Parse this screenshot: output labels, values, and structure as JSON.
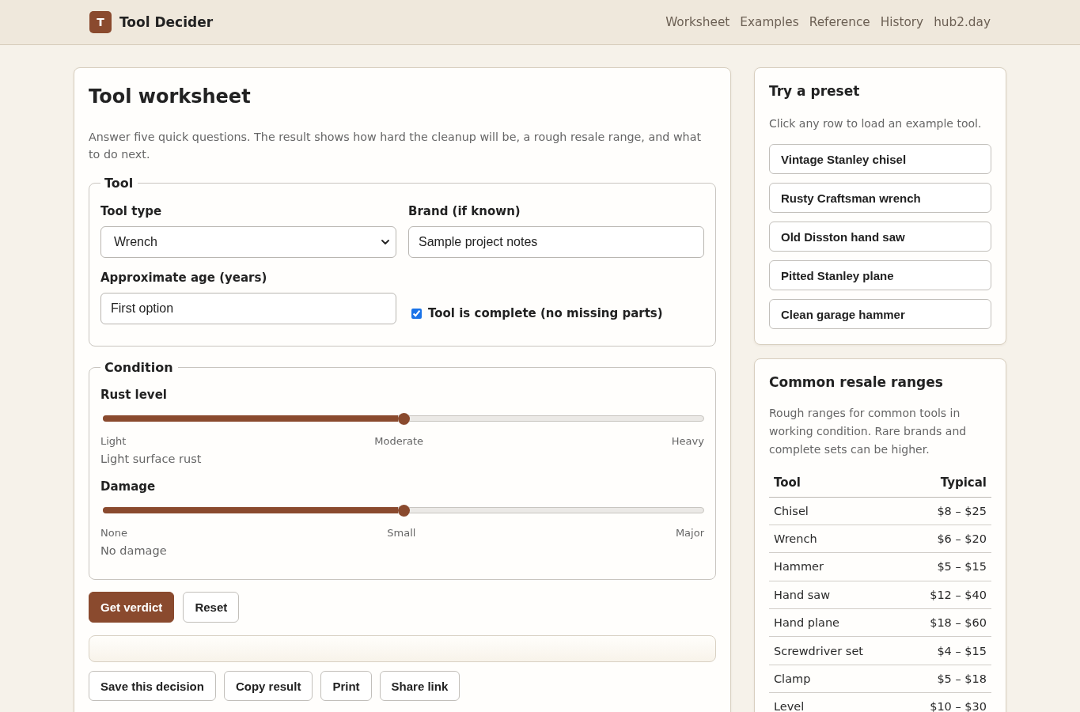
{
  "header": {
    "logo_letter": "T",
    "title": "Tool Decider",
    "nav": [
      "Worksheet",
      "Examples",
      "Reference",
      "History",
      "hub2.day"
    ]
  },
  "worksheet": {
    "title": "Tool worksheet",
    "description": "Answer five quick questions. The result shows how hard the cleanup will be, a rough resale range, and what to do next.",
    "tool_section": {
      "legend": "Tool",
      "tool_type": {
        "label": "Tool type",
        "value": "Wrench"
      },
      "brand": {
        "label": "Brand (if known)",
        "value": "Sample project notes"
      },
      "age": {
        "label": "Approximate age (years)",
        "value": "First option"
      },
      "complete": {
        "label": "Tool is complete (no missing parts)",
        "checked": true
      }
    },
    "condition_section": {
      "legend": "Condition",
      "sliders": [
        {
          "label": "Rust level",
          "level": 0.5,
          "ticks": [
            "Light",
            "Moderate",
            "Heavy"
          ],
          "note": "Light surface rust"
        },
        {
          "label": "Damage",
          "level": 0.5,
          "ticks": [
            "None",
            "Small",
            "Major"
          ],
          "note": "No damage"
        }
      ]
    },
    "primary_actions": [
      {
        "label": "Get verdict",
        "kind": "primary"
      },
      {
        "label": "Reset",
        "kind": "secondary"
      }
    ],
    "secondary_actions": [
      "Save this decision",
      "Copy result",
      "Print",
      "Share link"
    ]
  },
  "presets": {
    "title": "Try a preset",
    "description": "Click any row to load an example tool.",
    "items": [
      "Vintage Stanley chisel",
      "Rusty Craftsman wrench",
      "Old Disston hand saw",
      "Pitted Stanley plane",
      "Clean garage hammer"
    ]
  },
  "resale": {
    "title": "Common resale ranges",
    "description": "Rough ranges for common tools in working condition. Rare brands and complete sets can be higher.",
    "table": {
      "columns": [
        "Tool",
        "Typical"
      ],
      "rows": [
        [
          "Chisel",
          "$8 – $25"
        ],
        [
          "Wrench",
          "$6 – $20"
        ],
        [
          "Hammer",
          "$5 – $15"
        ],
        [
          "Hand saw",
          "$12 – $40"
        ],
        [
          "Hand plane",
          "$18 – $60"
        ],
        [
          "Screwdriver set",
          "$4 – $15"
        ],
        [
          "Clamp",
          "$5 – $18"
        ],
        [
          "Level",
          "$10 – $30"
        ]
      ]
    }
  }
}
